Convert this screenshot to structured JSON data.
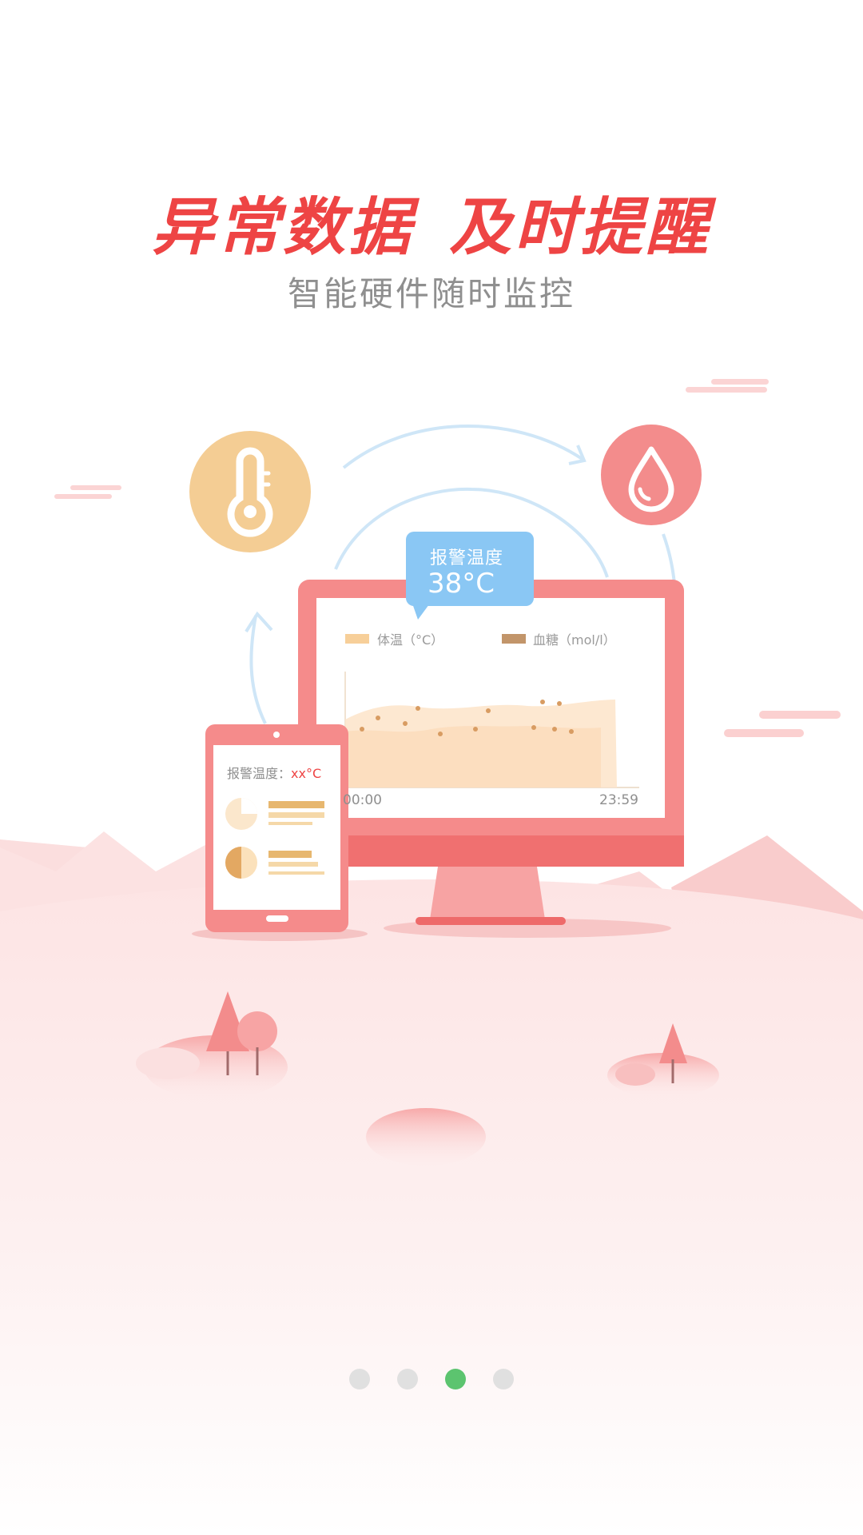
{
  "header": {
    "headline_part1": "异常数据",
    "headline_part2": "及时提醒",
    "subtitle": "智能硬件随时监控"
  },
  "illustration": {
    "alert_bubble": {
      "title": "报警温度",
      "value": "38°C"
    },
    "legend": {
      "temp_label": "体温（°C）",
      "sugar_label": "血糖（mol/l）"
    },
    "x_start": "00:00",
    "x_end": "23:59",
    "tablet_label": "报警温度：",
    "tablet_value": "xx°C",
    "icons": [
      "thermometer-icon",
      "water-drop-icon"
    ]
  },
  "pager": {
    "count": 4,
    "active_index": 2
  },
  "colors": {
    "brand_red": "#ee4444",
    "coral": "#f28a8a",
    "gold": "#f5cd94",
    "active_dot": "#5cc46f"
  }
}
